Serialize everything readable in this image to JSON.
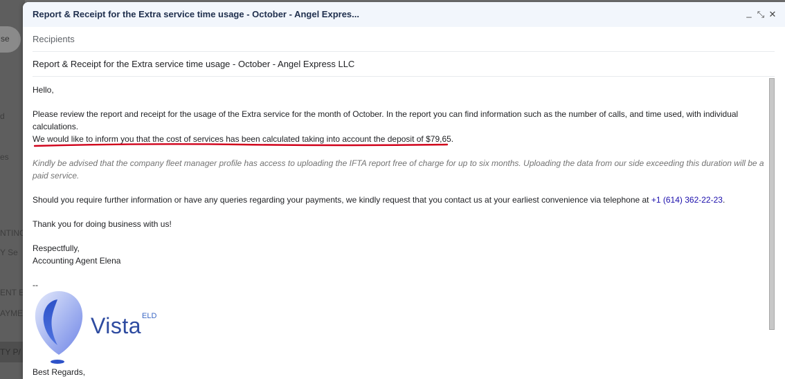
{
  "background": {
    "left_labels": [
      "se",
      "d",
      "es",
      "NTING",
      "Y Se",
      "ENT E",
      "AYMEN",
      "TY P/"
    ]
  },
  "compose": {
    "title": "Report & Receipt for the Extra service time usage - October - Angel Expres...",
    "controls": {
      "minimize": "_",
      "expand": "⤡",
      "close": "✕"
    },
    "recipients_placeholder": "Recipients",
    "subject": "Report & Receipt for the Extra service time usage - October - Angel Express LLC"
  },
  "body": {
    "greeting": "Hello,",
    "para1": "Please review the report and receipt for the usage of the Extra service for the month of October. In the report you can find information such as the number of calls, and time used, with individual calculations.",
    "deposit_line": "We would like to inform you that the cost of services has been calculated taking into account the deposit of $79,65.",
    "notice": "Kindly be advised that the company fleet manager profile has access to uploading the IFTA report free of charge for up to six months. Uploading the data from our side exceeding this duration will be a paid service.",
    "contact_text": "Should you require further information or have any queries regarding your payments, we kindly request that you contact us at your earliest convenience via telephone at ",
    "phone": "+1 (614) 362-22-23",
    "contact_end": ".",
    "thanks": "Thank you for doing business with us!",
    "closing": "Respectfully,",
    "signer": "Accounting Agent Elena",
    "separator": "--",
    "signoff": "Best Regards,"
  },
  "logo": {
    "word": "Vista",
    "superscript": "ELD"
  },
  "colors": {
    "accent_underline": "#d0021b",
    "link": "#1a0dab",
    "logo_blue": "#2e4ba0"
  }
}
